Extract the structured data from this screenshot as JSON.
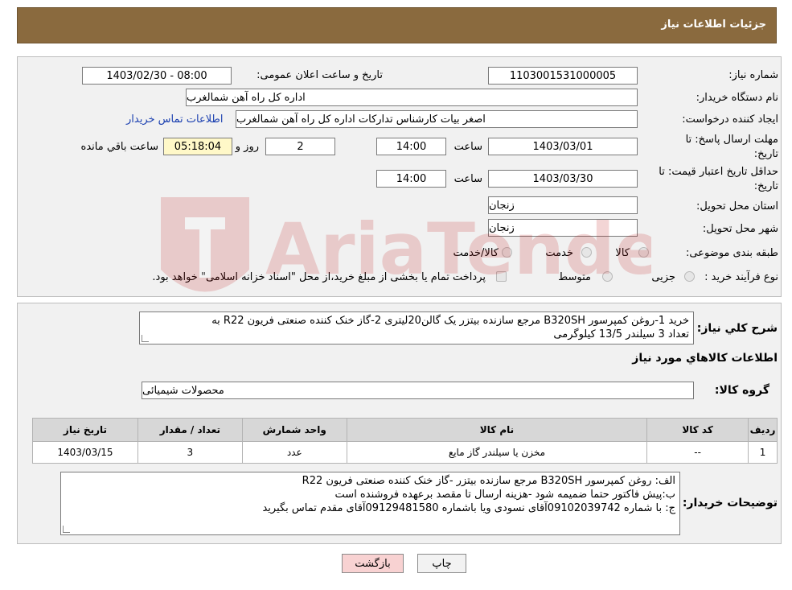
{
  "header": {
    "title": "جزئیات اطلاعات نیاز"
  },
  "form": {
    "need_number_label": "شماره نیاز:",
    "need_number": "1103001531000005",
    "announce_label": "تاریخ و ساعت اعلان عمومی:",
    "announce_value": "1403/02/30 - 08:00",
    "buyer_label": "نام دستگاه خریدار:",
    "buyer_value": "اداره کل راه آهن شمالغرب",
    "creator_label": "ایجاد کننده درخواست:",
    "creator_value": "اصغر بیات کارشناس تدارکات اداره کل راه آهن شمالغرب",
    "contact_link": "اطلاعات تماس خریدار",
    "deadline_label_1": "مهلت ارسال پاسخ: تا",
    "deadline_label_2": "تاریخ:",
    "deadline_date": "1403/03/01",
    "time_label": "ساعت",
    "deadline_time": "14:00",
    "days_value": "2",
    "days_label": "روز و",
    "remaining_time": "05:18:04",
    "remaining_label": "ساعت باقي مانده",
    "validity_label_1": "حداقل تاریخ اعتبار قیمت: تا",
    "validity_label_2": "تاریخ:",
    "validity_date": "1403/03/30",
    "validity_time": "14:00",
    "province_label": "استان محل تحویل:",
    "province_value": "زنجان",
    "city_label": "شهر محل تحویل:",
    "city_value": "زنجان",
    "category_label": "طبقه بندی موضوعی:",
    "category_opt_goods": "کالا",
    "category_opt_service": "خدمت",
    "category_opt_both": "کالا/خدمت",
    "process_label": "نوع فرآیند خرید :",
    "process_opt_partial": "جزیی",
    "process_opt_medium": "متوسط",
    "payment_note": "پرداخت تمام یا بخشی از مبلغ خرید،از محل \"اسناد خزانه اسلامی\" خواهد بود."
  },
  "details": {
    "summary_label": "شرح كلي نياز:",
    "summary_line1": "خرید 1-روغن کمپرسور B320SH مرجع سازنده بیتزر یک گالن20لیتری 2-گاز خنک کننده صنعتی فریون R22 به",
    "summary_line2": "تعداد 3 سیلندر 13/5 کیلوگرمی",
    "goods_info_title": "اطلاعات كالاهاي مورد نياز",
    "group_label": "گروه کالا:",
    "group_value": "محصولات شیمیائی"
  },
  "table": {
    "headers": {
      "row": "رديف",
      "code": "کد کالا",
      "name": "نام کالا",
      "unit": "واحد شمارش",
      "qty": "تعداد / مقدار",
      "date": "تاریخ نیاز"
    },
    "rows": [
      {
        "row": "1",
        "code": "--",
        "name": "مخزن یا سیلندر گاز مایع",
        "unit": "عدد",
        "qty": "3",
        "date": "1403/03/15"
      }
    ]
  },
  "buyer_notes": {
    "label": "توضیحات خریدار:",
    "line1": "الف: روغن کمپرسور B320SH مرجع سازنده بیتزر  -گاز خنک کننده صنعتی فریون R22",
    "line2": "ب:پیش فاکتور حتما ضمیمه شود -هزینه ارسال تا مقصد برعهده فروشنده است",
    "line3": "ج: با شماره  09102039742آقای  نسودی ویا باشماره  09129481580آقای مقدم تماس بگیرید"
  },
  "buttons": {
    "print": "چاپ",
    "back": "بازگشت"
  },
  "watermark": {
    "text": "AriaTender.neT"
  },
  "colors": {
    "header_bg": "#8a6a3e",
    "back_button_bg": "#f8d2d2",
    "timer_bg": "#fff8c8",
    "link": "#1a3fb0"
  }
}
